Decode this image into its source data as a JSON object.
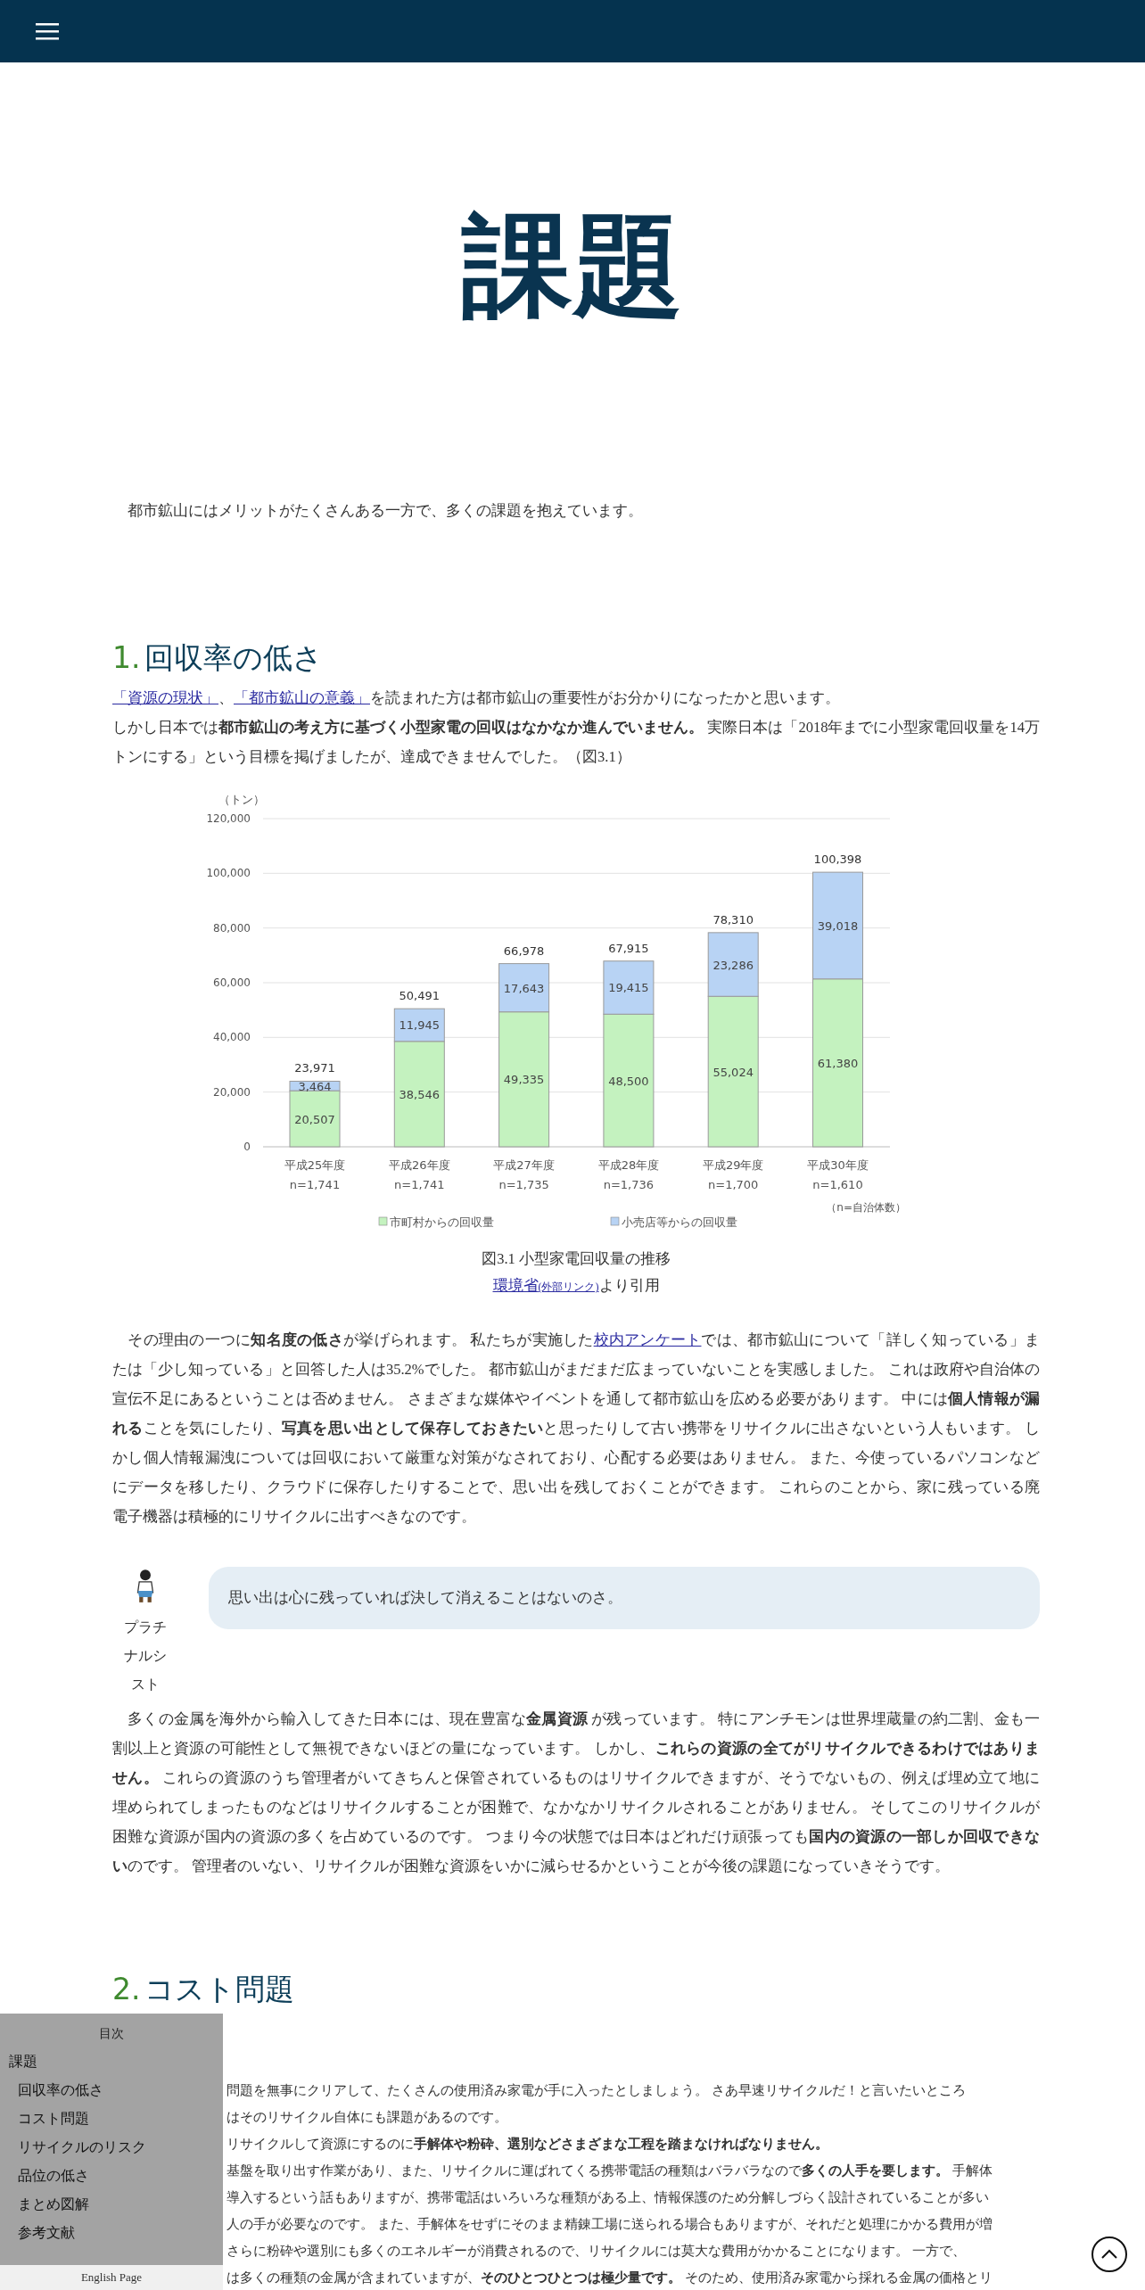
{
  "page_title": "課題",
  "intro": "　都市鉱山にはメリットがたくさんある一方で、多くの課題を抱えています。",
  "sections": [
    {
      "number": "1.",
      "title": "回収率の低さ",
      "blocks": [
        {
          "kind": "paragraph",
          "lines": [
            [
              {
                "kind": "link",
                "text": "「資源の現状」"
              },
              {
                "kind": "text",
                "text": "、"
              },
              {
                "kind": "link",
                "text": "「都市鉱山の意義」"
              },
              {
                "kind": "text",
                "text": "を読まれた方は都市鉱山の重要性がお分かりになったかと思います。"
              }
            ],
            [
              {
                "kind": "text",
                "text": "しかし日本では**都市鉱山の考え方に基づく小型家電の回収はなかなか進んでいません。** 実際日本は「2018年までに小型家電回収量を14万トンにする」という目標を掲げましたが、達成できませんでした。（図3.1）"
              }
            ]
          ]
        },
        {
          "kind": "figure",
          "caption": "図3.1 小型家電回収量の推移",
          "source": [
            {
              "kind": "link",
              "text": "環境省"
            },
            {
              "kind": "small_link",
              "text": "(外部リンク)"
            },
            {
              "kind": "text",
              "text": "より引用"
            }
          ],
          "chart_data": {
            "type": "bar",
            "stacked": true,
            "ylabel": "（トン）",
            "categories": [
              "平成25年度\nn=1,741",
              "平成26年度\nn=1,741",
              "平成27年度\nn=1,735",
              "平成28年度\nn=1,736",
              "平成29年度\nn=1,700",
              "平成30年度\nn=1,610"
            ],
            "series": [
              {
                "name": "市町村からの回収量",
                "color": "#c4f2bf",
                "values": [
                  20507,
                  38546,
                  49335,
                  48500,
                  55024,
                  61380
                ],
                "value_labels": [
                  "20,507",
                  "38,546",
                  "49,335",
                  "48,500",
                  "55,024",
                  "61,380"
                ]
              },
              {
                "name": "小売店等からの回収量",
                "color": "#b8d3f4",
                "values": [
                  3464,
                  11945,
                  17643,
                  19415,
                  23286,
                  39018
                ],
                "value_labels": [
                  "3,464",
                  "11,945",
                  "17,643",
                  "19,415",
                  "23,286",
                  "39,018"
                ]
              }
            ],
            "ylim": [
              0,
              120000
            ],
            "yticks": [
              {
                "value": 0,
                "label": "0"
              },
              {
                "value": 20000,
                "label": "20,000"
              },
              {
                "value": 40000,
                "label": "40,000"
              },
              {
                "value": 60000,
                "label": "60,000"
              },
              {
                "value": 80000,
                "label": "80,000"
              },
              {
                "value": 100000,
                "label": "100,000"
              },
              {
                "value": 120000,
                "label": "120,000"
              }
            ],
            "grid": true,
            "legend": true,
            "annotations": [
              {
                "x": "平成25年度\nn=1,741",
                "y": 23971,
                "text": "23,971"
              },
              {
                "x": "平成26年度\nn=1,741",
                "y": 50491,
                "text": "50,491"
              },
              {
                "x": "平成27年度\nn=1,735",
                "y": 66978,
                "text": "66,978"
              },
              {
                "x": "平成28年度\nn=1,736",
                "y": 67915,
                "text": "67,915"
              },
              {
                "x": "平成29年度\nn=1,700",
                "y": 78310,
                "text": "78,310"
              },
              {
                "x": "平成30年度\nn=1,610",
                "y": 100398,
                "text": "100,398"
              },
              {
                "text": "（n=自治体数）"
              }
            ]
          }
        },
        {
          "kind": "paragraph",
          "lines": [
            [
              {
                "kind": "text",
                "text": "　その理由の一つに**知名度の低さ**が挙げられます。 私たちが実施した"
              },
              {
                "kind": "link",
                "text": "校内アンケート"
              },
              {
                "kind": "text",
                "text": "では、都市鉱山について「詳しく知っている」または「少し知っている」と回答した人は35.2%でした。 都市鉱山がまだまだ広まっていないことを実感しました。 これは政府や自治体の宣伝不足にあるということは否めません。 さまざまな媒体やイベントを通して都市鉱山を広める必要があります。 中には**個人情報が漏れる**ことを気にしたり、**写真を思い出として保存しておきたい**と思ったりして古い携帯をリサイクルに出さないという人もいます。 しかし個人情報漏洩については回収において厳重な対策がなされており、心配する必要はありません。 また、今使っているパソコンなどにデータを移したり、クラウドに保存したりすることで、思い出を残しておくことができます。 これらのことから、家に残っている廃電子機器は積極的にリサイクルに出すべきなのです。"
              }
            ]
          ]
        },
        {
          "kind": "dialogue",
          "speaker": "プラチナルシスト",
          "text": "思い出は心に残っていれば決して消えることはないのさ。"
        },
        {
          "kind": "paragraph",
          "lines": [
            [
              {
                "kind": "text",
                "text": "　多くの金属を海外から輸入してきた日本には、現在豊富な**金属資源** が残っています。 特にアンチモンは世界埋蔵量の約二割、金も一割以上と資源の可能性として無視できないほどの量になっています。 しかし、**これらの資源の全てがリサイクルできるわけではありません。** これらの資源のうち管理者がいてきちんと保管されているものはリサイクルできますが、そうでないもの、例えば埋め立て地に埋められてしまったものなどはリサイクルすることが困難で、なかなかリサイクルされることがありません。 そしてこのリサイクルが困難な資源が国内の資源の多くを占めているのです。 つまり今の状態では日本はどれだけ頑張っても**国内の資源の一部しか回収できない**のです。 管理者のいない、リサイクルが困難な資源をいかに減らせるかということが今後の課題になっていきそうです。"
              }
            ]
          ]
        }
      ]
    },
    {
      "number": "2.",
      "title": "コスト問題",
      "blocks": [
        {
          "kind": "visible_lines",
          "lines": [
            "問題を無事にクリアして、たくさんの使用済み家電が手に入ったとしましょう。 さあ早速リサイクルだ！と言いたいところ",
            "はそのリサイクル自体にも課題があるのです。",
            "リサイクルして資源にするのに**手解体や粉砕、選別などさまざまな工程を踏まなければなりません。**",
            "基盤を取り出す作業があり、また、リサイクルに運ばれてくる携帯電話の種類はバラバラなので**多くの人手を要します。** 手解体",
            "導入するという話もありますが、携帯電話はいろいろな種類がある上、情報保護のため分解しづらく設計されていることが多い",
            "人の手が必要なのです。 また、手解体をせずにそのまま精錬工場に送られる場合もありますが、それだと処理にかかる費用が増",
            "さらに粉砕や選別にも多くのエネルギーが消費されるので、リサイクルには莫大な費用がかかることになります。 一方で、",
            "は多くの種類の金属が含まれていますが、**そのひとつひとつは極少量です。** そのため、使用済み家電から採れる金属の価格とリ"
          ]
        }
      ]
    }
  ],
  "toc": {
    "title": "目次",
    "items": [
      {
        "label": "課題",
        "children": [
          {
            "label": "回収率の低さ"
          },
          {
            "label": "コスト問題"
          },
          {
            "label": "リサイクルのリスク"
          },
          {
            "label": "品位の低さ"
          },
          {
            "label": "まとめ図解"
          },
          {
            "label": "参考文献"
          }
        ]
      }
    ],
    "language_link": "English Page"
  }
}
